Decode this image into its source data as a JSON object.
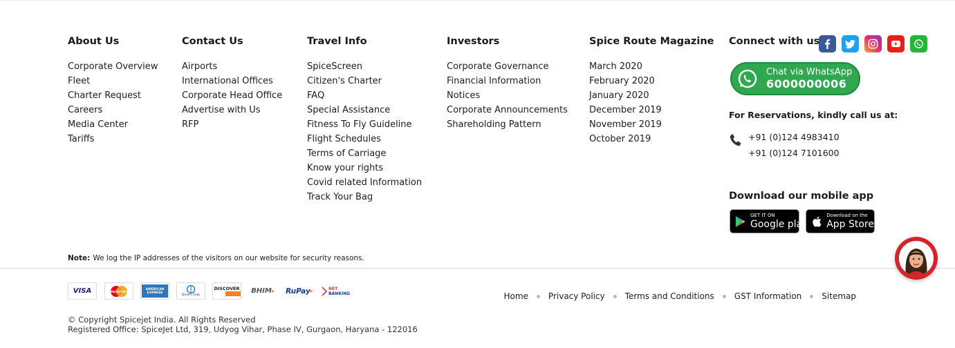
{
  "columns": [
    {
      "heading": "About Us",
      "items": [
        "Corporate Overview",
        "Fleet",
        "Charter Request",
        "Careers",
        "Media Center",
        "Tariffs"
      ]
    },
    {
      "heading": "Contact Us",
      "items": [
        "Airports",
        "International Offices",
        "Corporate Head Office",
        "Advertise with Us",
        "RFP"
      ]
    },
    {
      "heading": "Travel Info",
      "items": [
        "SpiceScreen",
        "Citizen's Charter",
        "FAQ",
        "Special Assistance",
        "Fitness To Fly Guideline",
        "Flight Schedules",
        "Terms of Carriage",
        "Know your rights",
        "Covid related Information",
        "Track Your Bag"
      ]
    },
    {
      "heading": "Investors",
      "items": [
        "Corporate Governance",
        "Financial Information",
        "Notices",
        "Corporate Announcements",
        "Shareholding Pattern"
      ]
    },
    {
      "heading": "Spice Route Magazine",
      "items": [
        "March 2020",
        "February 2020",
        "January 2020",
        "December 2019",
        "November 2019",
        "October 2019"
      ]
    }
  ],
  "connect": {
    "heading": "Connect with us",
    "socials": [
      {
        "icon": "facebook-icon",
        "color": "#3b5998"
      },
      {
        "icon": "twitter-icon",
        "color": "#1da1f2"
      },
      {
        "icon": "instagram-icon",
        "color": "#c13584"
      },
      {
        "icon": "youtube-icon",
        "color": "#e62117"
      },
      {
        "icon": "whatsapp-icon",
        "color": "#25b53a"
      }
    ],
    "whatsapp": {
      "line1": "Chat via WhatsApp",
      "number": "6000000006",
      "color": "#2fa84f"
    },
    "reservations_heading": "For Reservations, kindly call us at:",
    "phones": [
      "+91 (0)124 4983410",
      "+91 (0)124 7101600"
    ],
    "app_heading": "Download our mobile app",
    "google_play": {
      "small": "GET IT ON",
      "big": "Google play"
    },
    "app_store": {
      "small": "Download on the",
      "big": "App Store"
    }
  },
  "note": {
    "label": "Note:",
    "text": "We log the IP addresses of the visitors on our website for security reasons."
  },
  "payments": {
    "visa": "VISA",
    "mastercard": "MasterCard",
    "amex": "AMERICAN EXPRESS",
    "diners": "Diners Club",
    "discover": "DISCOVER",
    "bhim": "BHIM",
    "rupay": "RuPay",
    "netbanking_top": "NET",
    "netbanking_bottom": "BANKING"
  },
  "footer_links": [
    "Home",
    "Privacy Policy",
    "Terms and Conditions",
    "GST Information",
    "Sitemap"
  ],
  "copyright": "© Copyright Spicejet India. All Rights Reserved",
  "registered_office": "Registered Office: SpiceJet Ltd, 319, Udyog Vihar, Phase IV, Gurgaon, Haryana - 122016",
  "colors": {
    "accent_red": "#d5232a",
    "link_text": "#1d1d1d"
  }
}
